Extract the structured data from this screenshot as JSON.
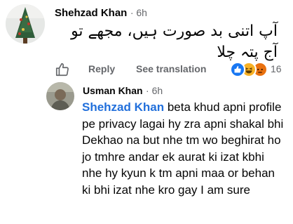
{
  "comment": {
    "author": "Shehzad Khan",
    "time": "6h",
    "text": "آپ اتنی بد صورت ہیں، مجھے تو آج پتہ چلا",
    "actions": {
      "reply_label": "Reply",
      "see_translation_label": "See translation"
    },
    "reactions": {
      "types": [
        "like-icon",
        "haha-icon",
        "angry-icon"
      ],
      "count": "16"
    }
  },
  "reply": {
    "author": "Usman Khan",
    "time": "6h",
    "mention": "Shehzad Khan",
    "text": " beta khud apni profile pe privacy lagai hy zra apni shakal bhi Dekhao na but nhe tm wo beghirat ho jo tmhre andar ek aurat ki izat kbhi nhe hy kyun k tm apni maa or behan ki bhi izat nhe kro gay I am sure"
  },
  "colors": {
    "mention": "#216fdb",
    "secondary_text": "#65676b",
    "like_blue": "#1877f2"
  }
}
